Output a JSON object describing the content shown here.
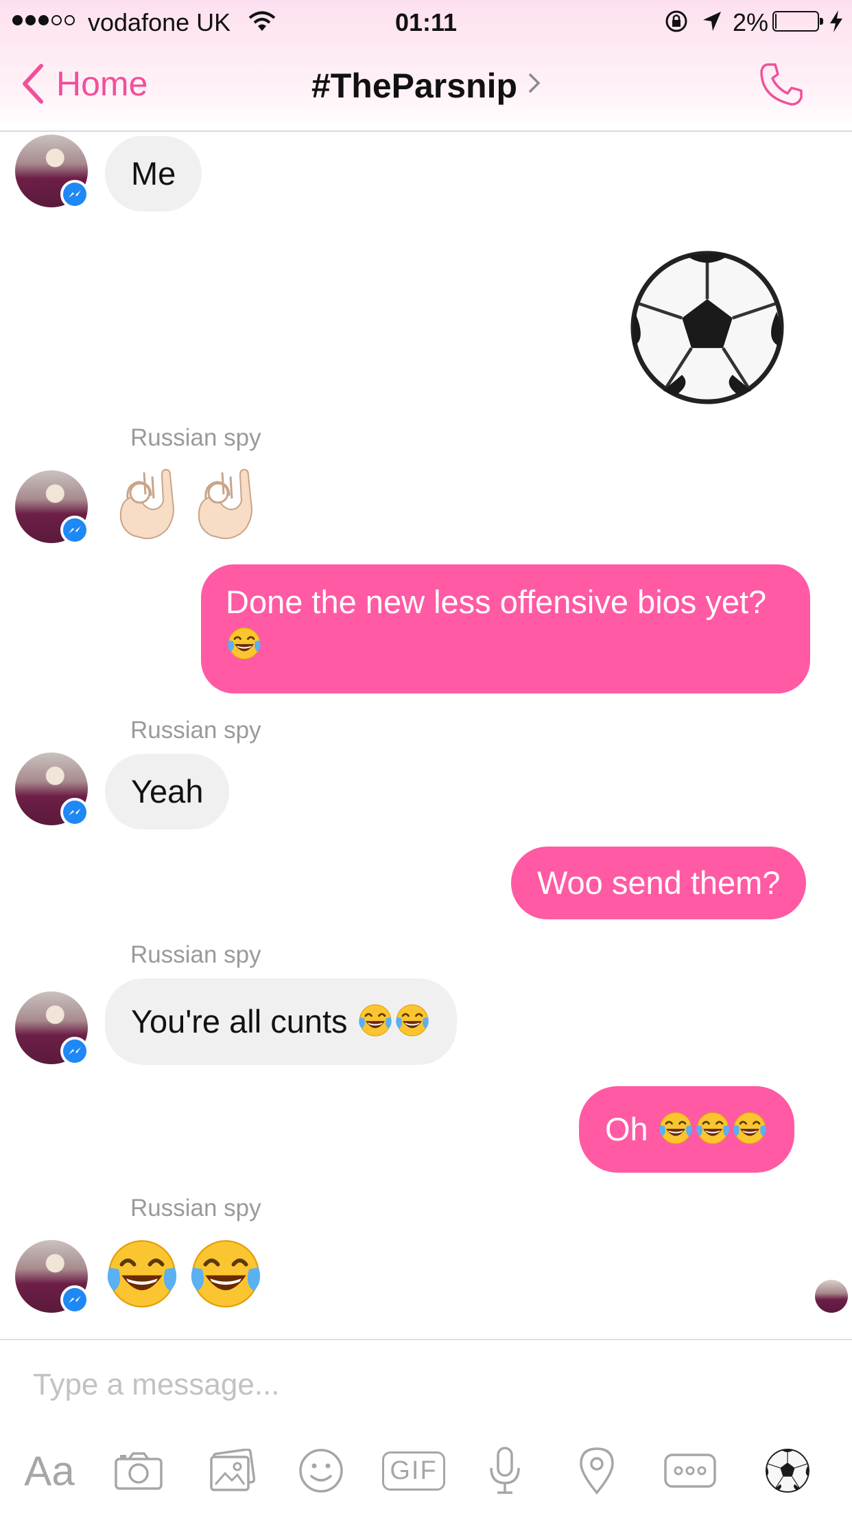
{
  "status_bar": {
    "carrier": "vodafone UK",
    "time": "01:11",
    "battery_percent": "2%",
    "battery_level": 0.02,
    "signal_bars_filled": 3,
    "signal_bars_total": 5
  },
  "nav": {
    "back_label": "Home",
    "title": "#TheParsnip",
    "accent_color": "#f0509a"
  },
  "messages": {
    "m1": {
      "text": "Me"
    },
    "m2": {
      "emoji": "soccer-ball"
    },
    "m3": {
      "sender": "Russian spy",
      "emoji": [
        "ok-hand",
        "ok-hand"
      ]
    },
    "m4": {
      "text": "Done the new less offensive bios yet?",
      "emoji": [
        "face-with-tears-of-joy"
      ]
    },
    "m5": {
      "sender": "Russian spy",
      "text": "Yeah"
    },
    "m6": {
      "text": "Woo send them?"
    },
    "m7": {
      "sender": "Russian spy",
      "text": "You're all cunts",
      "emoji": [
        "face-with-tears-of-joy",
        "face-with-tears-of-joy"
      ]
    },
    "m8": {
      "text": "Oh",
      "emoji": [
        "face-with-tears-of-joy",
        "face-with-tears-of-joy",
        "face-with-tears-of-joy"
      ]
    },
    "m9": {
      "sender": "Russian spy",
      "emoji": [
        "face-with-tears-of-joy",
        "face-with-tears-of-joy"
      ]
    }
  },
  "bubble_colors": {
    "incoming": "#f1f0f0",
    "outgoing": "#ff5aa3"
  },
  "composer": {
    "placeholder": "Type a message...",
    "text_format_label": "Aa",
    "gif_label": "GIF",
    "icons": [
      "camera-icon",
      "gallery-icon",
      "emoji-icon",
      "gif-icon",
      "microphone-icon",
      "location-icon",
      "more-icon",
      "soccer-ball-icon"
    ]
  }
}
